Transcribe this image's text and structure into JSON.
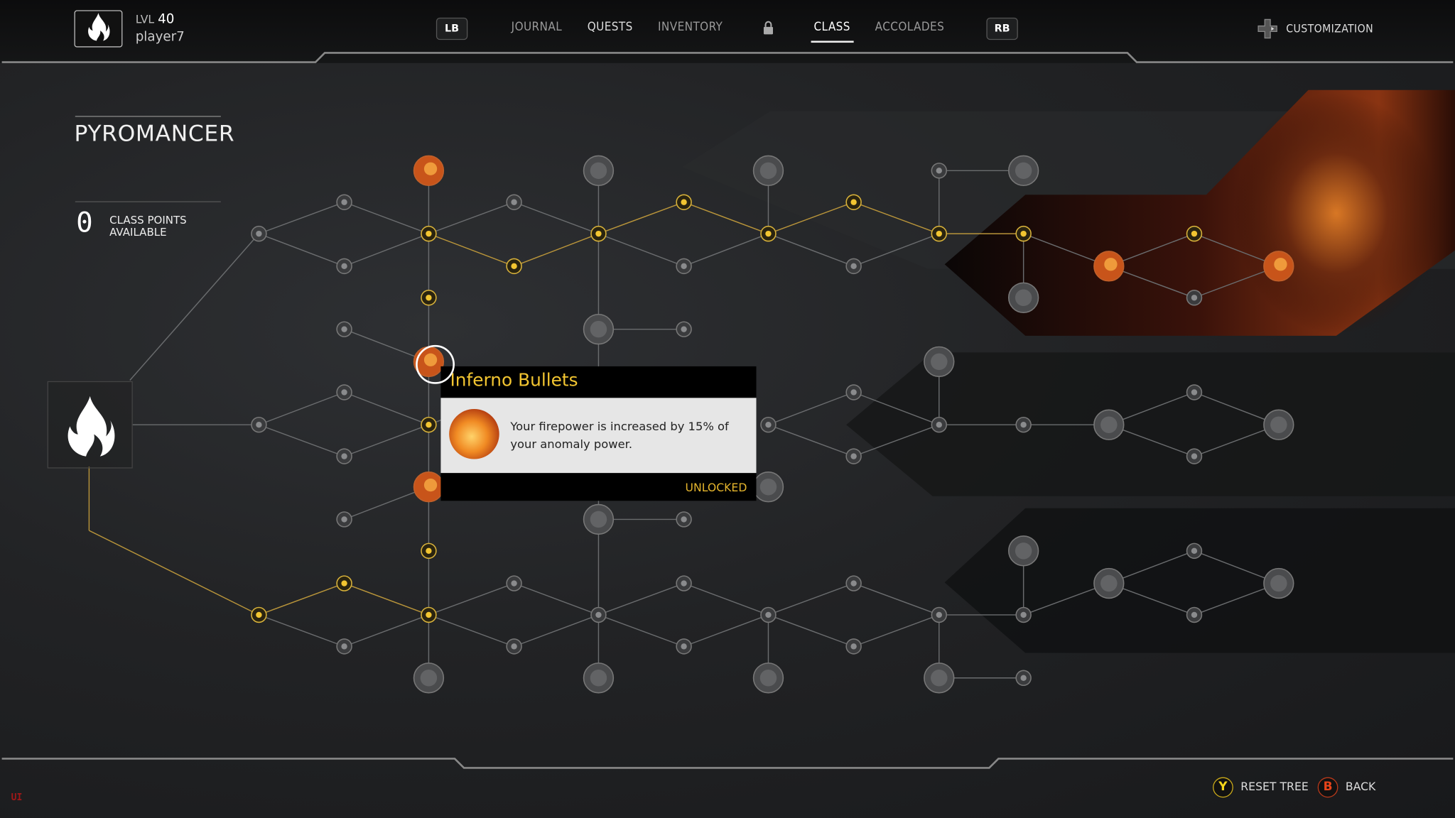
{
  "player": {
    "level_label": "LVL",
    "level": "40",
    "name": "player7",
    "class_icon": "flame-icon"
  },
  "nav": {
    "lb": "LB",
    "rb": "RB",
    "tabs": [
      {
        "label": "JOURNAL",
        "active": false
      },
      {
        "label": "QUESTS",
        "active": false
      },
      {
        "label": "INVENTORY",
        "active": false
      },
      {
        "label": "CLASS",
        "active": true
      },
      {
        "label": "ACCOLADES",
        "active": false
      }
    ],
    "locked_icon": "lock-icon",
    "customization": "CUSTOMIZATION"
  },
  "class_panel": {
    "title": "PYROMANCER",
    "points": "0",
    "points_label_1": "CLASS POINTS",
    "points_label_2": "AVAILABLE"
  },
  "tooltip": {
    "title": "Inferno Bullets",
    "description": "Your firepower is increased by 15% of your anomaly power.",
    "status": "UNLOCKED"
  },
  "footer": {
    "reset_key": "Y",
    "reset_label": "RESET TREE",
    "back_key": "B",
    "back_label": "BACK",
    "debug_tag": "UI"
  },
  "colors": {
    "accent": "#f2c531",
    "unlocked_line": "#b8943a",
    "locked_line": "#6a6c6e",
    "fire": "#e8641c",
    "back_button": "#e0431a"
  },
  "skill_tree": {
    "selected_node": "Inferno Bullets",
    "node_states": "a=active skill / u=unlocked / l=locked",
    "states": [
      "u",
      "l",
      "l",
      "l",
      "l",
      "l",
      "l",
      "u",
      "u",
      "l",
      "u",
      "u",
      "u",
      "u",
      "u",
      "u",
      "l",
      "u",
      "l",
      "l",
      "l",
      "u",
      "l",
      "l",
      "u",
      "u",
      "u",
      "u",
      "l",
      "l",
      "l",
      "l",
      "l",
      "u",
      "l",
      "l",
      "l",
      "l",
      "l",
      "l",
      "l",
      "l",
      "l",
      "l",
      "l",
      "l",
      "l",
      "u",
      "l",
      "u",
      "u",
      "u",
      "l",
      "l",
      "l",
      "l",
      "l",
      "l",
      "l",
      "l",
      "l",
      "l",
      "l",
      "l",
      "l",
      "l",
      "l",
      "l",
      "l",
      "l",
      "l",
      "l",
      "l",
      "l",
      "l",
      "l"
    ]
  }
}
